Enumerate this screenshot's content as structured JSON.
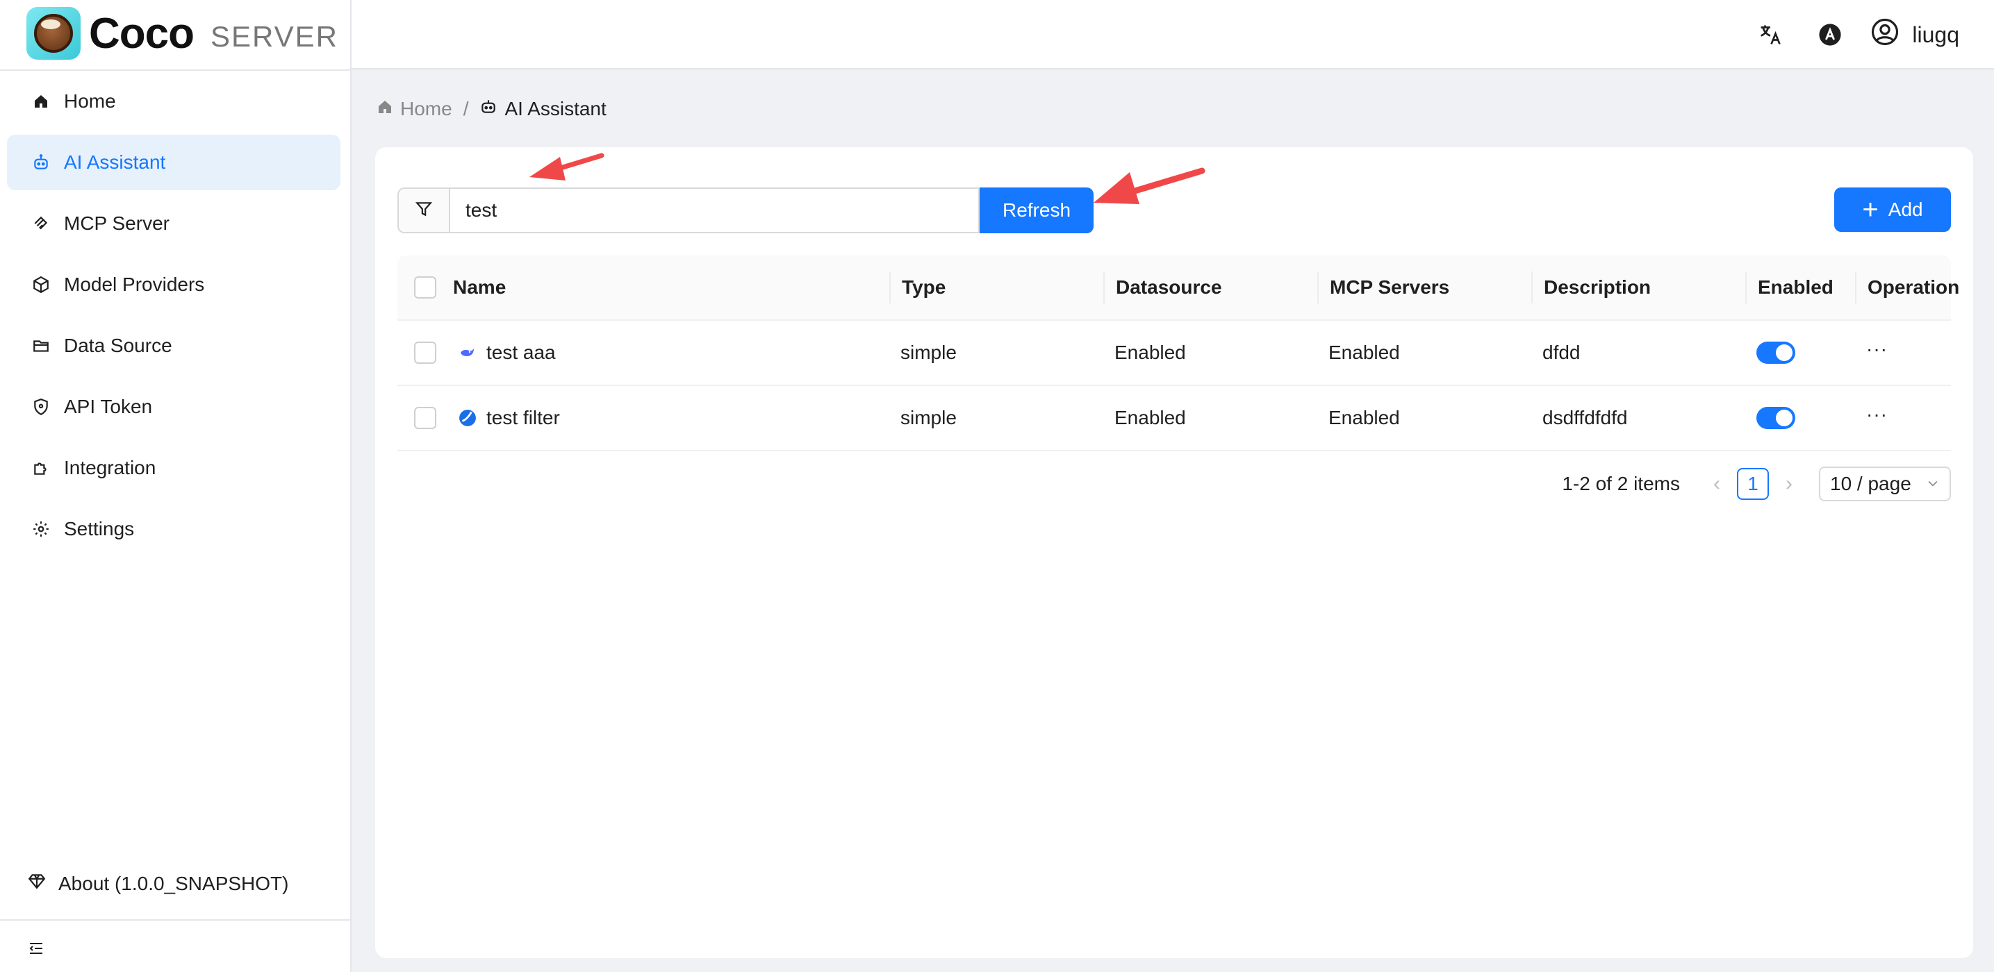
{
  "brand": {
    "name": "Coco",
    "sub": "SERVER"
  },
  "sidebar": {
    "items": [
      {
        "label": "Home",
        "icon": "home-icon",
        "active": false
      },
      {
        "label": "AI Assistant",
        "icon": "robot-icon",
        "active": true
      },
      {
        "label": "MCP Server",
        "icon": "mcp-icon",
        "active": false
      },
      {
        "label": "Model Providers",
        "icon": "cube-icon",
        "active": false
      },
      {
        "label": "Data Source",
        "icon": "folder-icon",
        "active": false
      },
      {
        "label": "API Token",
        "icon": "shield-icon",
        "active": false
      },
      {
        "label": "Integration",
        "icon": "puzzle-icon",
        "active": false
      },
      {
        "label": "Settings",
        "icon": "gear-icon",
        "active": false
      }
    ],
    "about": "About (1.0.0_SNAPSHOT)"
  },
  "header": {
    "username": "liugq"
  },
  "breadcrumb": {
    "home": "Home",
    "separator": "/",
    "current": "AI Assistant"
  },
  "search": {
    "value": "test",
    "refresh_label": "Refresh"
  },
  "toolbar": {
    "add_label": "Add"
  },
  "table": {
    "columns": [
      "Name",
      "Type",
      "Datasource",
      "MCP Servers",
      "Description",
      "Enabled",
      "Operation"
    ],
    "rows": [
      {
        "name": "test aaa",
        "type": "simple",
        "datasource": "Enabled",
        "mcp": "Enabled",
        "description": "dfdd",
        "enabled": true,
        "operation": "···"
      },
      {
        "name": "test filter",
        "type": "simple",
        "datasource": "Enabled",
        "mcp": "Enabled",
        "description": "dsdffdfdfd",
        "enabled": true,
        "operation": "···"
      }
    ]
  },
  "pagination": {
    "total": "1-2 of 2 items",
    "current_page": "1",
    "page_size": "10 / page"
  },
  "colors": {
    "primary": "#1677ff",
    "annotation": "#f04848",
    "active_bg": "#e6f1fc"
  }
}
